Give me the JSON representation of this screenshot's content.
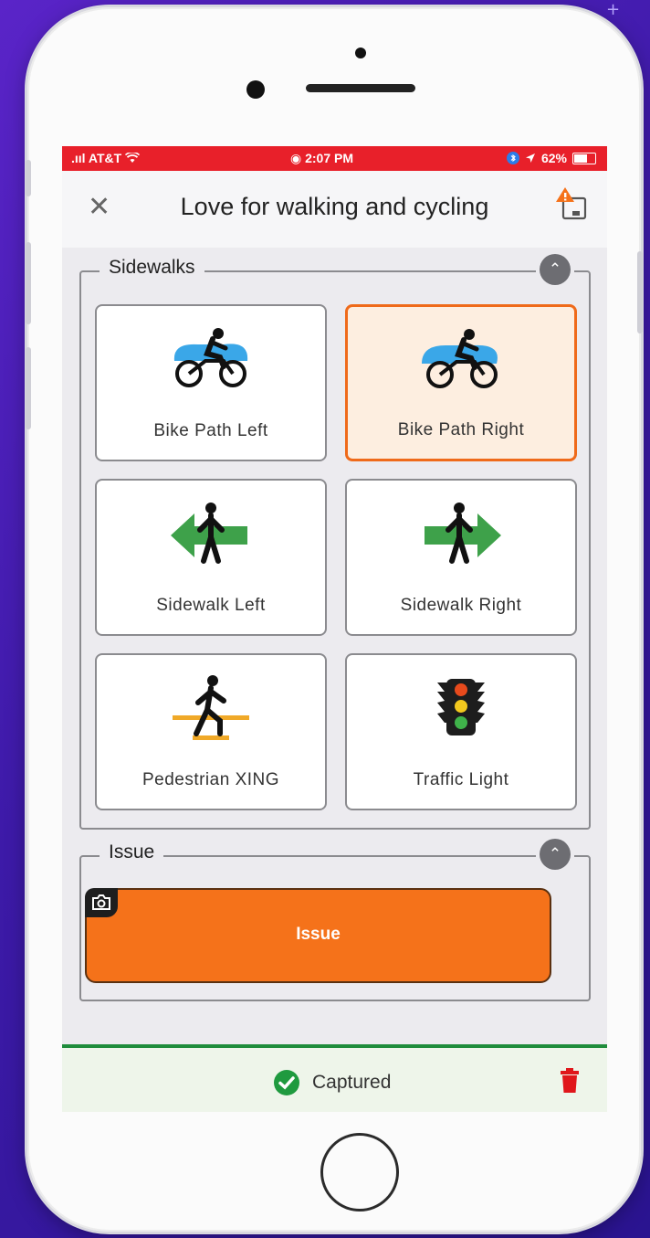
{
  "status_bar": {
    "carrier": ".ııl AT&T",
    "time": "2:07 PM",
    "battery": "62%"
  },
  "header": {
    "close_icon": "close-icon",
    "title": "Love for walking and cycling",
    "action_icon": "share-icon"
  },
  "sections": [
    {
      "label": "Sidewalks",
      "tiles": [
        {
          "label": "Bike Path Left",
          "icon": "bike-left-icon",
          "selected": false
        },
        {
          "label": "Bike Path Right",
          "icon": "bike-right-icon",
          "selected": true
        },
        {
          "label": "Sidewalk Left",
          "icon": "sidewalk-left-icon",
          "selected": false
        },
        {
          "label": "Sidewalk Right",
          "icon": "sidewalk-right-icon",
          "selected": false
        },
        {
          "label": "Pedestrian XING",
          "icon": "pedestrian-crossing-icon",
          "selected": false
        },
        {
          "label": "Traffic Light",
          "icon": "traffic-light-icon",
          "selected": false
        }
      ]
    },
    {
      "label": "Issue",
      "button_label": "Issue"
    }
  ],
  "footer": {
    "status": "Captured",
    "delete_icon": "trash-icon"
  },
  "colors": {
    "status_bar": "#e8202a",
    "accent_orange": "#f5721a",
    "selected_border": "#ef6a1a",
    "captured_green": "#1f9a3f"
  }
}
